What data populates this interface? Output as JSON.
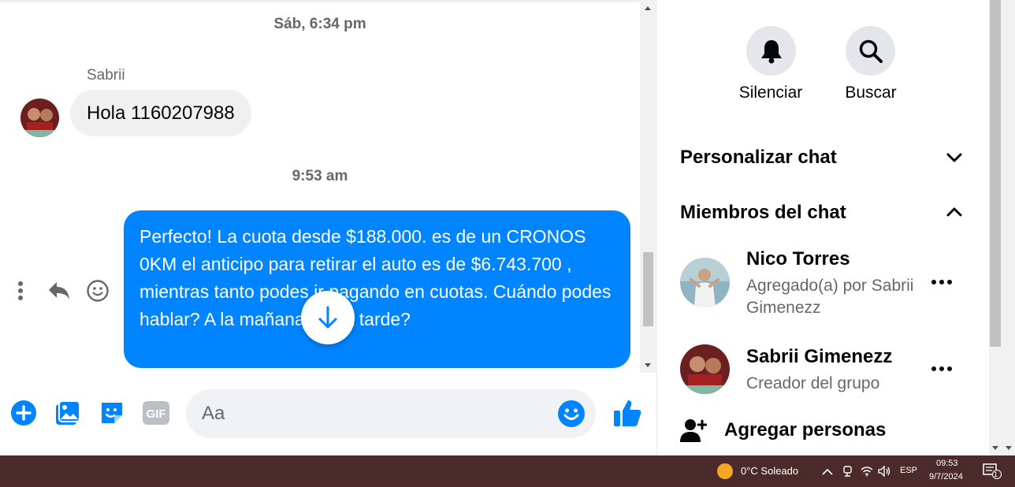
{
  "chat": {
    "timestamp_1": "Sáb, 6:34 pm",
    "sender_name": "Sabrii",
    "incoming_message": "Hola 1160207988",
    "timestamp_2": "9:53 am",
    "outgoing_message": "Perfecto! La cuota desde $188.000. es de un CRONOS 0KM el anticipo para retirar el auto es de $6.743.700 , mientras tanto podes ir pagando en cuotas. Cuándo podes hablar? A la mañana o a la tarde?",
    "message_actions": [
      "more-icon",
      "reply-icon",
      "emoji-react-icon"
    ]
  },
  "composer": {
    "placeholder": "Aa",
    "icons": [
      "plus-icon",
      "photo-icon",
      "sticker-icon",
      "gif-icon",
      "emoji-icon",
      "like-icon"
    ],
    "gif_label": "GIF"
  },
  "panel": {
    "mute_label": "Silenciar",
    "search_label": "Buscar",
    "customize_label": "Personalizar chat",
    "members_label": "Miembros del chat",
    "members": [
      {
        "name": "Nico Torres",
        "subtitle": "Agregado(a) por Sabrii Gimenezz"
      },
      {
        "name": "Sabrii Gimenezz",
        "subtitle": "Creador del grupo"
      }
    ],
    "add_people_label": "Agregar personas"
  },
  "taskbar": {
    "weather": "0°C  Soleado",
    "language": "ESP",
    "time": "09:53",
    "date": "9/7/2024",
    "notification_count": "1"
  },
  "colors": {
    "brand_blue": "#0084ff",
    "bubble_gray": "#f0f0f0",
    "taskbar": "#4a2a2a"
  }
}
